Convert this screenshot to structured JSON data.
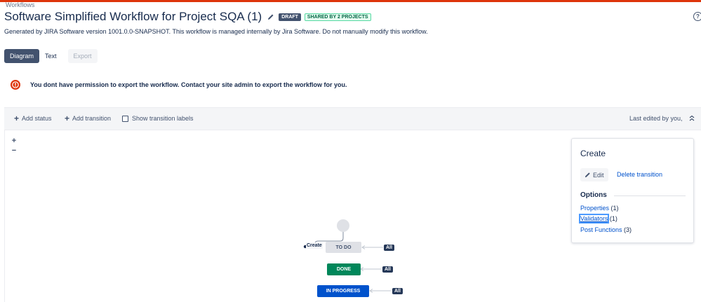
{
  "breadcrumb": "Workflows",
  "header": {
    "title": "Software Simplified Workflow for Project SQA (1)",
    "draft_badge": "DRAFT",
    "shared_badge": "SHARED BY 2 PROJECTS",
    "help_icon": "help-icon",
    "description": "Generated by JIRA Software version 1001.0.0-SNAPSHOT. This workflow is managed internally by Jira Software. Do not manually modify this workflow."
  },
  "tabs": [
    {
      "label": "Diagram",
      "state": "active"
    },
    {
      "label": "Text",
      "state": "normal"
    },
    {
      "label": "Export",
      "state": "disabled"
    }
  ],
  "warning": {
    "message": "You dont have permission to export the workflow. Contact your site admin to export the workflow for you.",
    "color": "#de350b"
  },
  "toolbar": {
    "add_status": "Add status",
    "add_transition": "Add transition",
    "show_labels": "Show transition labels",
    "last_edited": "Last edited by you,"
  },
  "zoom": {
    "in": "+",
    "out": "−"
  },
  "diagram": {
    "create_label": "Create",
    "statuses": [
      {
        "label": "TO DO",
        "color": "#dfe1e6"
      },
      {
        "label": "DONE",
        "color": "#00875a"
      },
      {
        "label": "IN PROGRESS",
        "color": "#0052cc"
      }
    ],
    "all_badge": "All"
  },
  "panel": {
    "title": "Create",
    "edit": "Edit",
    "delete": "Delete transition",
    "options_heading": "Options",
    "options": [
      {
        "link": "Properties",
        "count": "(1)"
      },
      {
        "link": "Validators",
        "count": "(1)"
      },
      {
        "link": "Post Functions",
        "count": "(3)"
      }
    ]
  },
  "colors": {
    "accent": "#0052cc",
    "topbar": "#de350b"
  }
}
